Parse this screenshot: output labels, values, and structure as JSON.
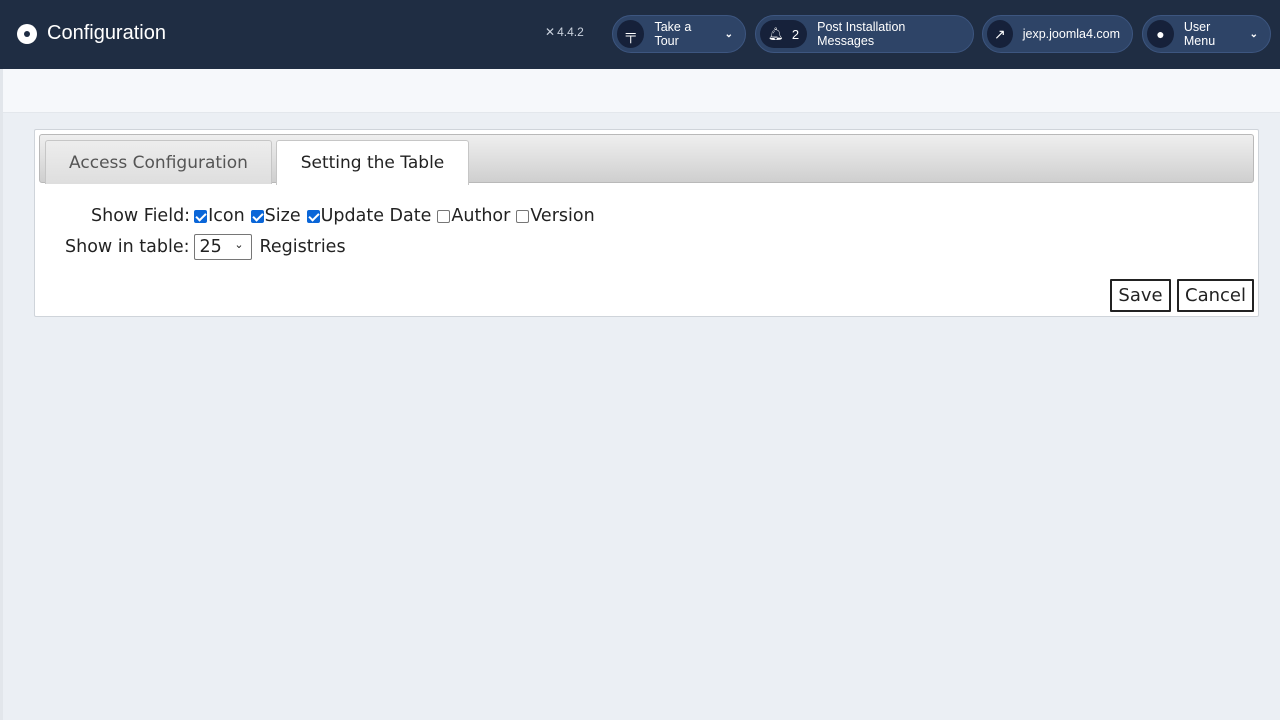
{
  "header": {
    "title": "Configuration",
    "version": "4.4.2",
    "tour_label": "Take a Tour",
    "notifications_count": "2",
    "post_install_label": "Post Installation Messages",
    "site_label": "jexp.joomla4.com",
    "user_menu_label": "User Menu",
    "colors": {
      "background": "#1f2d43",
      "button": "#2e4467"
    }
  },
  "tabs": {
    "items": [
      {
        "label": "Access Configuration",
        "active": false
      },
      {
        "label": "Setting the Table",
        "active": true
      }
    ]
  },
  "form": {
    "show_field_label": "Show Field:",
    "fields": [
      {
        "label": "Icon",
        "checked": true
      },
      {
        "label": "Size",
        "checked": true
      },
      {
        "label": "Update Date",
        "checked": true
      },
      {
        "label": "Author",
        "checked": false
      },
      {
        "label": "Version",
        "checked": false
      }
    ],
    "show_in_table_label": "Show in table:",
    "rows_value": "25",
    "registries_label": "Registries"
  },
  "actions": {
    "save_label": "Save",
    "cancel_label": "Cancel"
  }
}
